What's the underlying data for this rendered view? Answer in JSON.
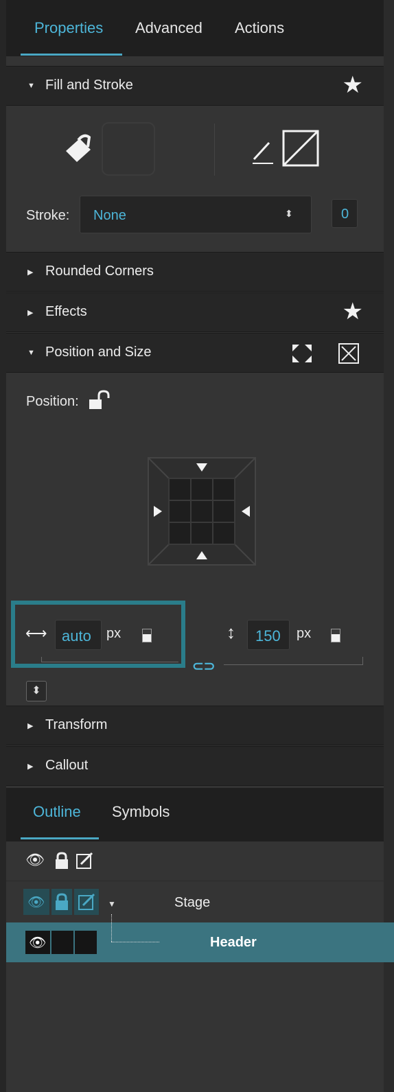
{
  "tabs": [
    {
      "label": "Properties",
      "active": true
    },
    {
      "label": "Advanced",
      "active": false
    },
    {
      "label": "Actions",
      "active": false
    }
  ],
  "sections": {
    "fill_stroke": {
      "label": "Fill and Stroke",
      "expanded": true
    },
    "rounded_corners": {
      "label": "Rounded Corners",
      "expanded": false
    },
    "effects": {
      "label": "Effects",
      "expanded": false
    },
    "position_size": {
      "label": "Position and Size",
      "expanded": true
    },
    "transform": {
      "label": "Transform",
      "expanded": false
    },
    "callout": {
      "label": "Callout",
      "expanded": false
    }
  },
  "stroke": {
    "label": "Stroke:",
    "selected": "None",
    "width_value": "0"
  },
  "position": {
    "label": "Position:",
    "width_value": "auto",
    "width_unit": "px",
    "height_value": "150",
    "height_unit": "px"
  },
  "outline_tabs": [
    {
      "label": "Outline",
      "active": true
    },
    {
      "label": "Symbols",
      "active": false
    }
  ],
  "outline": {
    "rows": [
      {
        "label": "Stage",
        "selected": false
      },
      {
        "label": "Header",
        "selected": true
      }
    ]
  },
  "colors": {
    "accent": "#4db6d9",
    "selected_row": "#3b7480",
    "highlight_box": "#2a7d8a"
  }
}
